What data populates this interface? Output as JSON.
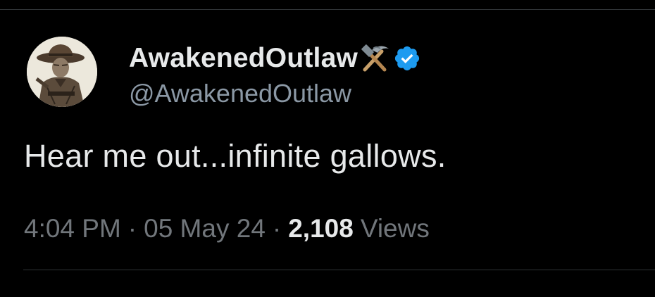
{
  "tweet": {
    "author": {
      "display_name": "AwakenedOutlaw",
      "handle": "@AwakenedOutlaw",
      "name_emoji": "hammer-and-pick-icon",
      "verified_badge": "verified-badge-icon",
      "verified_color": "#1d9bf0"
    },
    "text": "Hear me out...infinite gallows.",
    "meta": {
      "time": "4:04 PM",
      "separator": "·",
      "date": "05 May 24",
      "views_count": "2,108",
      "views_label": "Views"
    }
  },
  "colors": {
    "background": "#000000",
    "primary_text": "#e7e9ea",
    "secondary_text": "#71767b",
    "divider": "#2f3336"
  }
}
